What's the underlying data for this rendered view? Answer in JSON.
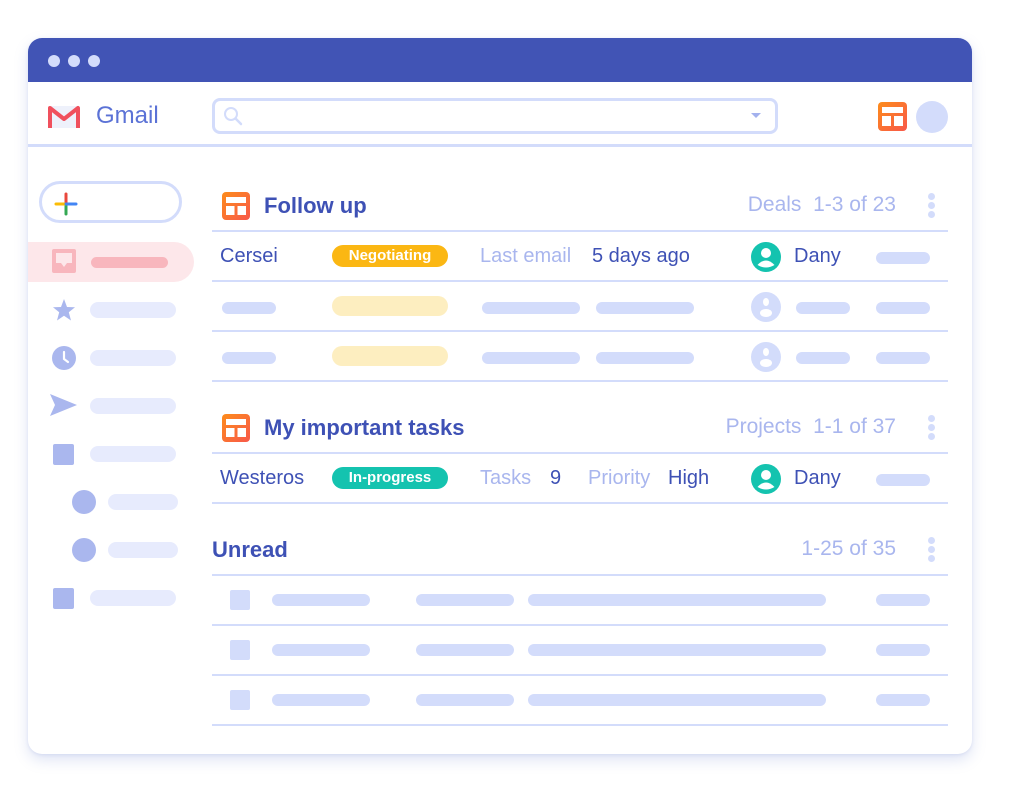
{
  "window": {
    "title_bar_dots": 3
  },
  "colors": {
    "titlebar": "#4154b5",
    "accent_text": "#3e51b5",
    "muted_text": "#a9b6ee",
    "placeholder_bar": "#d3dcfb",
    "negotiating_badge": "#fbb713",
    "inprogress_badge": "#14c3af",
    "active_nav": "#fde7ea"
  },
  "header": {
    "app_name": "Gmail",
    "search": {
      "value": "",
      "placeholder": ""
    },
    "icons": [
      "gmail-logo-icon",
      "search-icon",
      "dropdown-caret-icon",
      "apps-layout-icon",
      "avatar"
    ]
  },
  "sidebar": {
    "compose_icon": "plus-icon",
    "items": [
      {
        "icon": "inbox-icon",
        "active": true
      },
      {
        "icon": "star-icon",
        "active": false
      },
      {
        "icon": "clock-icon",
        "active": false
      },
      {
        "icon": "send-icon",
        "active": false
      },
      {
        "icon": "square-label-icon",
        "active": false
      },
      {
        "icon": "circle-label-icon",
        "active": false,
        "indent": true
      },
      {
        "icon": "circle-label-icon",
        "active": false,
        "indent": true
      },
      {
        "icon": "square-label-icon",
        "active": false
      }
    ]
  },
  "sections": {
    "follow_up": {
      "title": "Follow up",
      "meta_label": "Deals",
      "meta_range": "1-3 of 23",
      "rows": [
        {
          "name": "Cersei",
          "status": "Negotiating",
          "field_label": "Last email",
          "field_value": "5 days ago",
          "owner": "Dany"
        }
      ],
      "placeholder_rows": 2
    },
    "tasks": {
      "title": "My important tasks",
      "meta_label": "Projects",
      "meta_range": "1-1 of 37",
      "rows": [
        {
          "name": "Westeros",
          "status": "In-progress",
          "field1_label": "Tasks",
          "field1_value": "9",
          "field2_label": "Priority",
          "field2_value": "High",
          "owner": "Dany"
        }
      ]
    },
    "unread": {
      "title": "Unread",
      "meta_range": "1-25 of 35",
      "placeholder_rows": 3
    }
  }
}
